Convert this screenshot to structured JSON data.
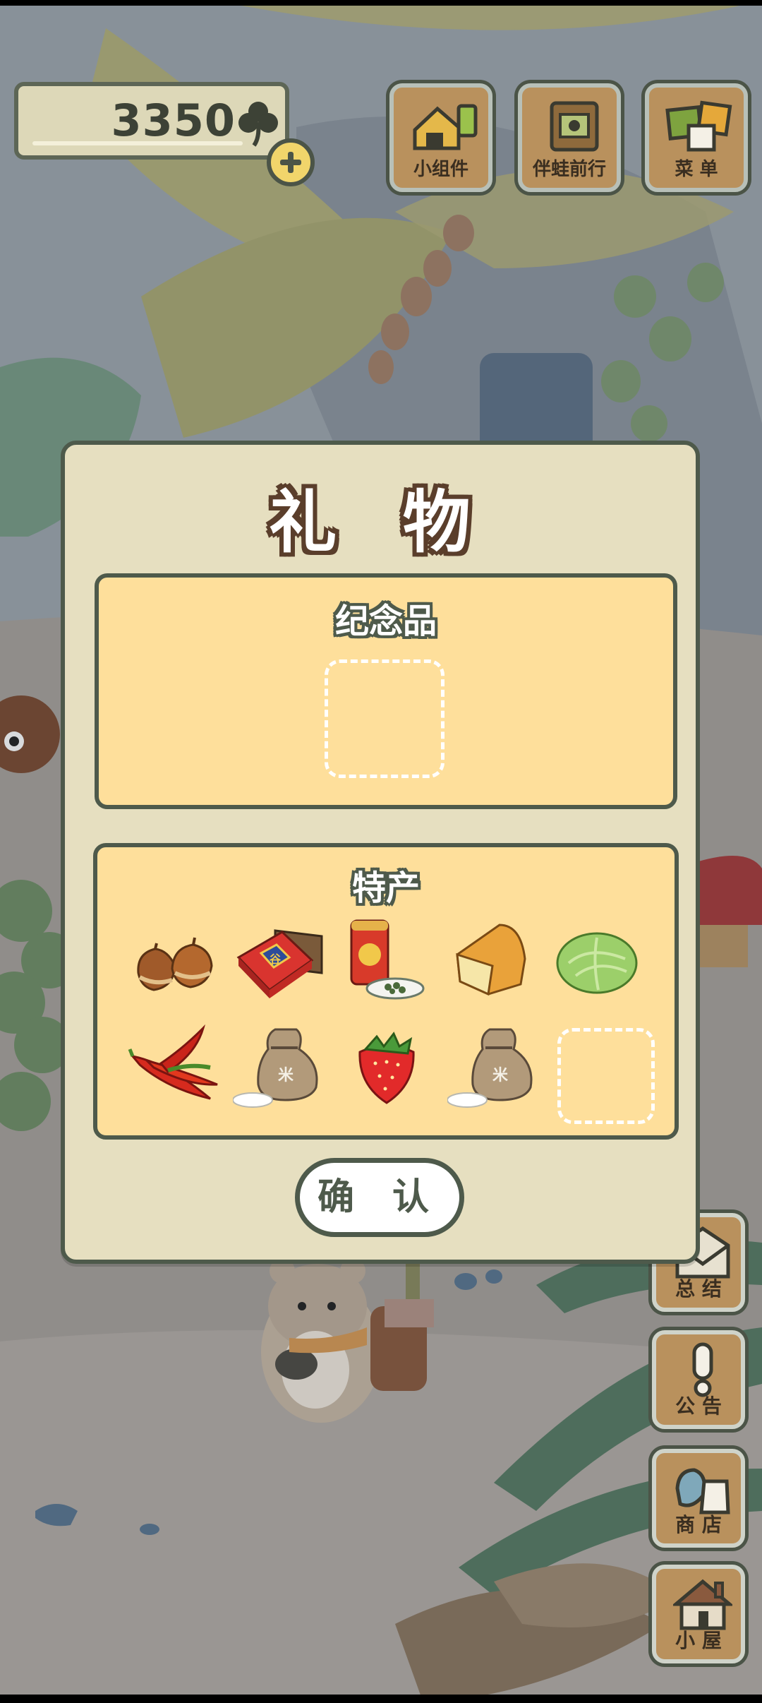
{
  "currency": {
    "clover_count": "3350",
    "icon": "clover-icon",
    "add_icon": "plus-icon"
  },
  "top_buttons": [
    {
      "label": "小组件",
      "icon": "widget-icon"
    },
    {
      "label": "伴蛙前行",
      "icon": "album-icon"
    },
    {
      "label": "菜 单",
      "icon": "menu-icon"
    }
  ],
  "side_buttons": [
    {
      "label": "总 结",
      "icon": "mail-icon"
    },
    {
      "label": "公 告",
      "icon": "exclamation-icon"
    },
    {
      "label": "商 店",
      "icon": "shop-bags-icon"
    },
    {
      "label": "小 屋",
      "icon": "house-icon"
    }
  ],
  "dialog": {
    "title": "礼 物",
    "souvenir_section": {
      "title": "纪念品",
      "slots": [
        {
          "item": null
        }
      ]
    },
    "specialty_section": {
      "title": "特产",
      "items": [
        {
          "name": "chestnuts",
          "icon": "chestnuts-icon"
        },
        {
          "name": "gift-box",
          "icon": "gift-box-icon"
        },
        {
          "name": "tea-can",
          "icon": "tea-can-icon"
        },
        {
          "name": "cheese",
          "icon": "cheese-icon"
        },
        {
          "name": "cabbage",
          "icon": "cabbage-icon"
        },
        {
          "name": "chili-peppers",
          "icon": "chili-peppers-icon"
        },
        {
          "name": "rice-sack",
          "icon": "rice-sack-icon"
        },
        {
          "name": "strawberry",
          "icon": "strawberry-icon"
        },
        {
          "name": "rice-sack",
          "icon": "rice-sack-icon"
        },
        {
          "name": null,
          "icon": "empty-slot"
        }
      ],
      "sack_label": "米",
      "box_label": "谷"
    },
    "confirm_label": "确 认"
  },
  "colors": {
    "dialog_bg": "#e6dfc0",
    "panel_bg": "#fedf9b",
    "outline": "#4e5a4b",
    "wood": "#b9915d"
  }
}
